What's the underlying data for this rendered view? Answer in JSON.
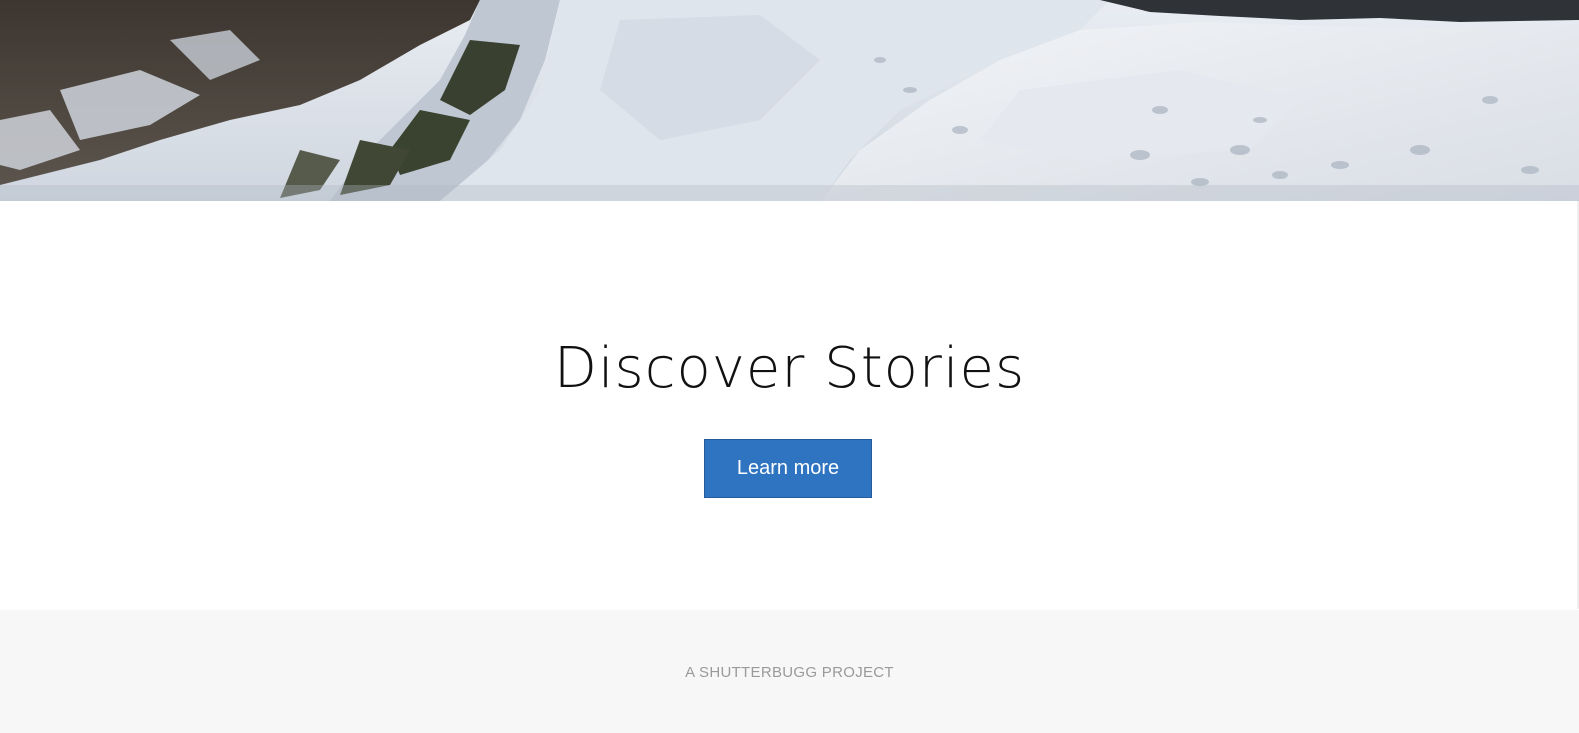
{
  "hero": {
    "image": "snowy-mountain-photo"
  },
  "cta": {
    "title": "Discover Stories",
    "button_label": "Learn more",
    "button_color": "#2f74c0"
  },
  "footer": {
    "text": "A SHUTTERBUGG PROJECT",
    "background_color": "#f7f7f7"
  }
}
